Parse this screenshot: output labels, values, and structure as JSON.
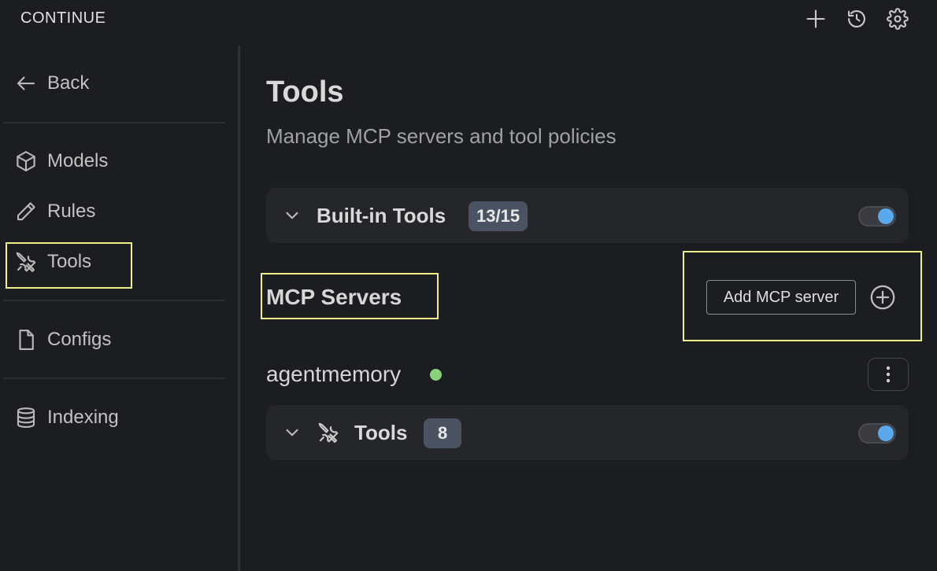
{
  "header": {
    "app_title": "CONTINUE",
    "icons": [
      "plus-icon",
      "history-icon",
      "gear-icon"
    ]
  },
  "sidebar": {
    "back_label": "Back",
    "items": [
      {
        "label": "Models",
        "icon": "cube-icon"
      },
      {
        "label": "Rules",
        "icon": "pencil-icon"
      },
      {
        "label": "Tools",
        "icon": "wrench-screwdriver-icon",
        "active": true
      },
      {
        "label": "Configs",
        "icon": "document-icon"
      },
      {
        "label": "Indexing",
        "icon": "database-icon"
      }
    ]
  },
  "main": {
    "title": "Tools",
    "subtitle": "Manage MCP servers and tool policies",
    "builtin": {
      "title": "Built-in Tools",
      "badge": "13/15",
      "enabled": true
    },
    "mcp": {
      "section_title": "MCP Servers",
      "add_button_label": "Add MCP server",
      "servers": [
        {
          "name": "agentmemory",
          "status_color": "#8bd17c",
          "tools_label": "Tools",
          "tools_count": "8",
          "enabled": true
        }
      ]
    }
  },
  "colors": {
    "background": "#1c1d20",
    "card": "#25262a",
    "accent_toggle": "#5aa9ec",
    "badge": "#4b5262",
    "highlight": "#efef8a"
  }
}
